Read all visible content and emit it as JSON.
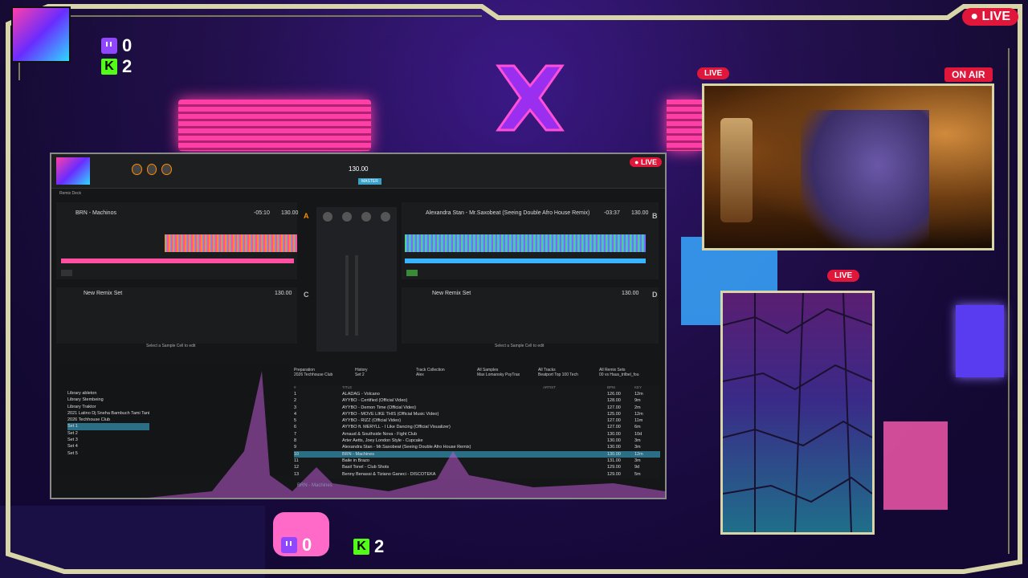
{
  "overlay": {
    "live_badge": "LIVE",
    "twitch_count_top": "0",
    "kick_count_top": "2",
    "twitch_count_bottom": "0",
    "kick_count_bottom": "2",
    "colors": {
      "twitch": "#9146ff",
      "kick": "#53fc18",
      "live": "#e0163a",
      "frame": "#d8d6a8"
    }
  },
  "webcam": {
    "live_label": "LIVE",
    "on_air_label": "ON AIR"
  },
  "panel": {
    "live_label": "LIVE"
  },
  "dj_app": {
    "live_badge": "LIVE",
    "master_bpm": "130.00",
    "remix_deck_label": "Remix Deck",
    "deck_a": {
      "title": "BRN - Machinos",
      "time": "-05:10",
      "tempo": "130.00",
      "letter": "A"
    },
    "deck_b": {
      "title": "Alexandra Stan - Mr.Saxobeat (Seeing Double Afro House Remix)",
      "time": "-03:37",
      "tempo": "130.00",
      "letter": "B"
    },
    "deck_c": {
      "title": "New Remix Set",
      "tempo": "130.00",
      "letter": "C"
    },
    "deck_d": {
      "title": "New Remix Set",
      "tempo": "130.00",
      "letter": "D"
    },
    "select_cell_left": "Select a Sample Cell to edit",
    "select_cell_right": "Select a Sample Cell to edit",
    "tree": [
      "Library ableton",
      "Library Stembeing",
      "Library Traktor",
      "2021 Latino Dj Sneha Bambuch Tami Tani",
      "2026 Techhouse Club",
      "Set 1",
      "Set 2",
      "Set 3",
      "Set 4",
      "Set 5"
    ],
    "favorites": [
      "Preparation",
      "History",
      "Track Collection",
      "All Samples",
      "All Tracks",
      "All Remix Sets",
      "2026 Techhouse Club",
      "Set 2",
      "Alex",
      "Max Lomansky PsyTrax",
      "Beatport Top 100 Tech",
      "00 vs Haus_trilbel_fou"
    ],
    "columns": [
      "#",
      "TITLE",
      "ARTIST",
      "BPM",
      "KEY"
    ],
    "tracks": [
      {
        "n": "1",
        "title": "ALADAG - Volcano",
        "bpm": "126.00",
        "key": "12m"
      },
      {
        "n": "2",
        "title": "AYYBO - Certified (Official Video)",
        "bpm": "128.00",
        "key": "9m"
      },
      {
        "n": "3",
        "title": "AYYBO - Demon Time (Official Video)",
        "bpm": "127.00",
        "key": "2m"
      },
      {
        "n": "4",
        "title": "AYYBO - MOVE LIKE THIS (Official Music Video)",
        "bpm": "125.00",
        "key": "12m"
      },
      {
        "n": "5",
        "title": "AYYBO - RIZZ (Official Video)",
        "bpm": "127.00",
        "key": "11m"
      },
      {
        "n": "6",
        "title": "AYYBO ft. MERYLL - I Like Dancing (Official Visualizer)",
        "bpm": "127.00",
        "key": "6m"
      },
      {
        "n": "7",
        "title": "Arnaud & Southside Nova - Fight Club",
        "bpm": "130.00",
        "key": "10d"
      },
      {
        "n": "8",
        "title": "Arter Aetts, Joey London Style - Cupcake",
        "bpm": "130.00",
        "key": "3m"
      },
      {
        "n": "9",
        "title": "Alexandra Stan - Mr.Saxobeat (Seeing Double Afro House Remix)",
        "bpm": "130.00",
        "key": "3m"
      },
      {
        "n": "10",
        "title": "BRN - Machines",
        "bpm": "130.00",
        "key": "12m"
      },
      {
        "n": "11",
        "title": "Baile in Brazo",
        "bpm": "131.00",
        "key": "3m"
      },
      {
        "n": "12",
        "title": "Basil Tonel - Club Shots",
        "bpm": "129.00",
        "key": "9d"
      },
      {
        "n": "13",
        "title": "Benny Benassi & Tiziano Ganeci - DISCOTEKA",
        "bpm": "129.00",
        "key": "5m"
      }
    ],
    "now_playing": "BRN - Machines"
  }
}
